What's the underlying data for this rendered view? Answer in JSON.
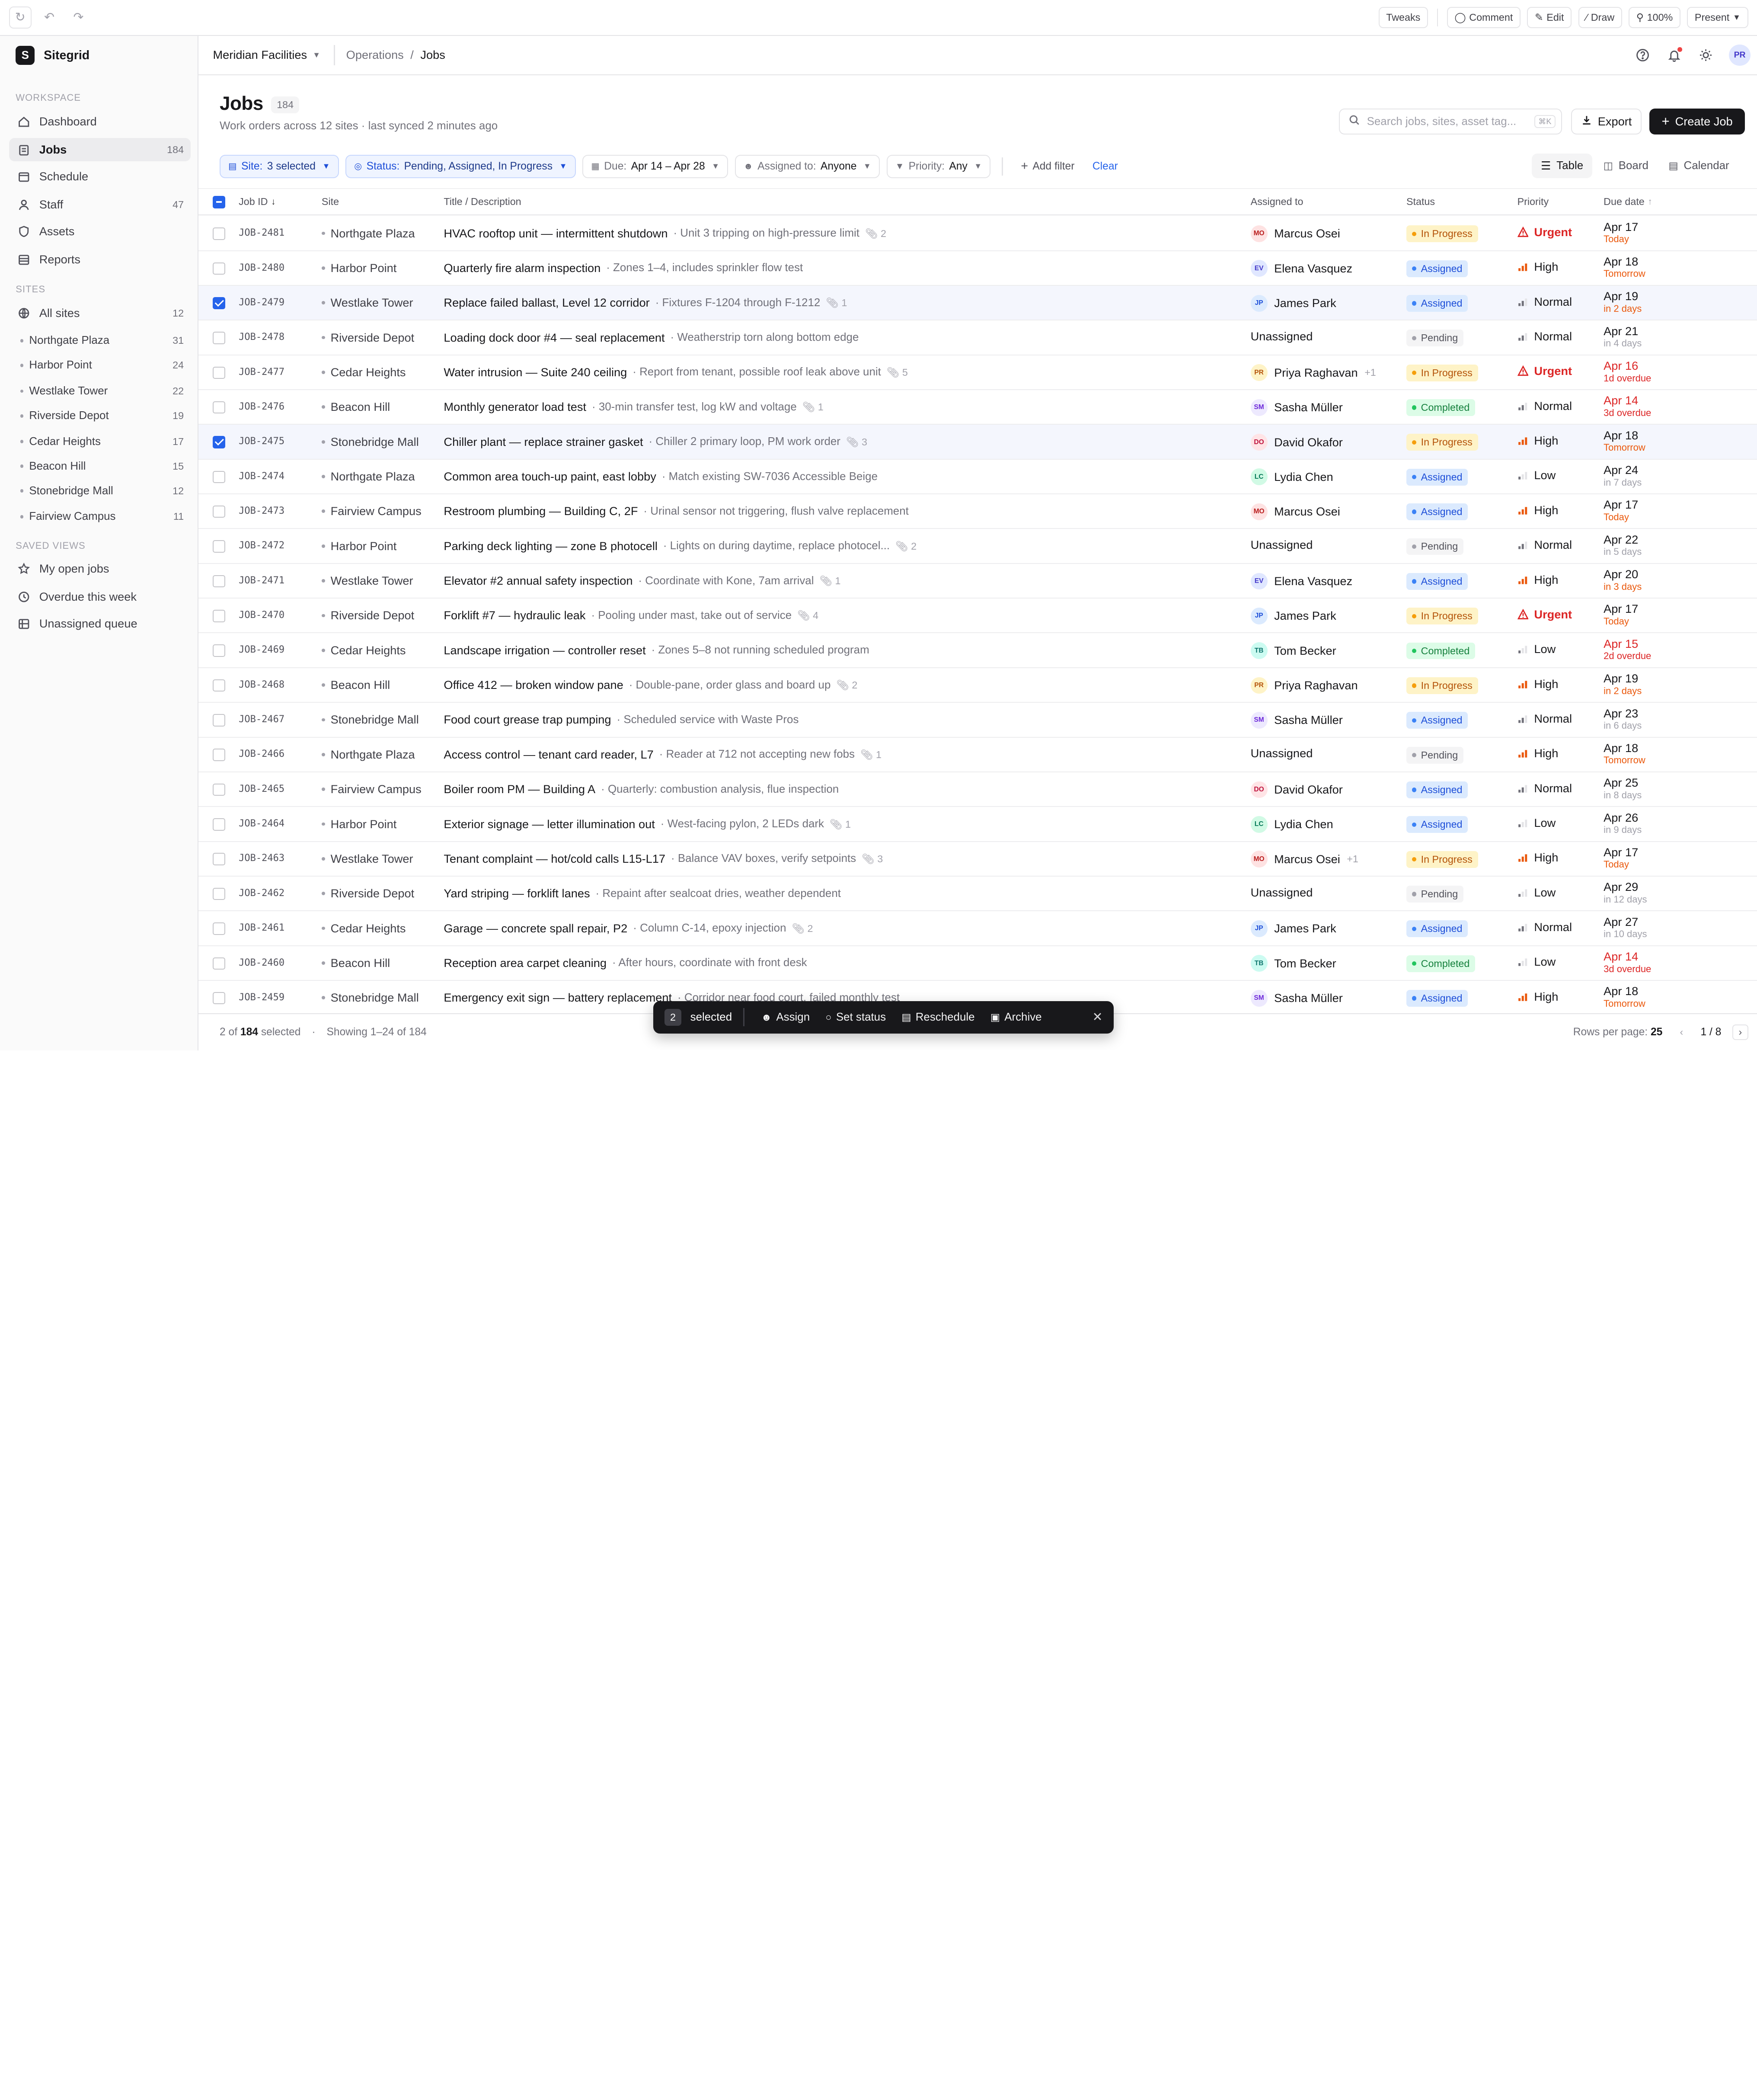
{
  "topbar": {
    "tweaks": "Tweaks",
    "comment": "Comment",
    "edit": "Edit",
    "draw": "Draw",
    "zoom": "100%",
    "present": "Present"
  },
  "brand": {
    "logo": "S",
    "name": "Sitegrid"
  },
  "org": {
    "name": "Meridian Facilities"
  },
  "breadcrumb": {
    "parent": "Operations",
    "sep": "/",
    "current": "Jobs"
  },
  "user": {
    "initials": "PR"
  },
  "sidebar": {
    "workspace_label": "WORKSPACE",
    "nav": [
      {
        "label": "Dashboard",
        "count": "",
        "icon": "home-icon"
      },
      {
        "label": "Jobs",
        "count": "184",
        "icon": "clipboard-icon"
      },
      {
        "label": "Schedule",
        "count": "",
        "icon": "calendar-icon"
      },
      {
        "label": "Staff",
        "count": "47",
        "icon": "user-icon"
      },
      {
        "label": "Assets",
        "count": "",
        "icon": "shield-icon"
      },
      {
        "label": "Reports",
        "count": "",
        "icon": "report-icon"
      }
    ],
    "sites_label": "SITES",
    "all_sites": {
      "label": "All sites",
      "count": "12"
    },
    "sites": [
      {
        "label": "Northgate Plaza",
        "count": "31"
      },
      {
        "label": "Harbor Point",
        "count": "24"
      },
      {
        "label": "Westlake Tower",
        "count": "22"
      },
      {
        "label": "Riverside Depot",
        "count": "19"
      },
      {
        "label": "Cedar Heights",
        "count": "17"
      },
      {
        "label": "Beacon Hill",
        "count": "15"
      },
      {
        "label": "Stonebridge Mall",
        "count": "12"
      },
      {
        "label": "Fairview Campus",
        "count": "11"
      }
    ],
    "views_label": "SAVED VIEWS",
    "views": [
      {
        "label": "My open jobs",
        "icon": "star-icon"
      },
      {
        "label": "Overdue this week",
        "icon": "clock-icon"
      },
      {
        "label": "Unassigned queue",
        "icon": "queue-icon"
      }
    ]
  },
  "page": {
    "title": "Jobs",
    "count": "184",
    "subtitle": "Work orders across 12 sites · last synced 2 minutes ago"
  },
  "search": {
    "placeholder": "Search jobs, sites, asset tag...",
    "kbd": "⌘K"
  },
  "actions": {
    "export": "Export",
    "create": "Create Job"
  },
  "filters": [
    {
      "key": "Site:",
      "value": "3 selected",
      "active": true
    },
    {
      "key": "Status:",
      "value": "Pending, Assigned, In Progress",
      "active": true
    },
    {
      "key": "Due:",
      "value": "Apr 14 – Apr 28",
      "active": false
    },
    {
      "key": "Assigned to:",
      "value": "Anyone",
      "active": false
    },
    {
      "key": "Priority:",
      "value": "Any",
      "active": false
    }
  ],
  "add_filter": "Add filter",
  "clear": "Clear",
  "views": {
    "table": "Table",
    "board": "Board",
    "calendar": "Calendar"
  },
  "columns": {
    "id": "Job ID",
    "site": "Site",
    "title": "Title / Description",
    "assigned": "Assigned to",
    "status": "Status",
    "priority": "Priority",
    "due": "Due date"
  },
  "colors": {
    "accent": "#2563eb",
    "urgent": "#dc2626",
    "high": "#ea580c",
    "overdue": "#dc2626",
    "soon": "#ea580c"
  },
  "rows": [
    {
      "id": "JOB-2481",
      "site": "Northgate Plaza",
      "title": "HVAC rooftop unit — intermittent shutdown",
      "desc": "· Unit 3 tripping on high-pressure limit",
      "att": "2",
      "initials": "MO",
      "assignee": "Marcus Osei",
      "plus": "",
      "status": "In Progress",
      "priority": "Urgent",
      "due": "Apr 17",
      "due_sub": "Today",
      "due_state": "soon",
      "checked": false
    },
    {
      "id": "JOB-2480",
      "site": "Harbor Point",
      "title": "Quarterly fire alarm inspection",
      "desc": "· Zones 1–4, includes sprinkler flow test",
      "att": "",
      "initials": "EV",
      "assignee": "Elena Vasquez",
      "plus": "",
      "status": "Assigned",
      "priority": "High",
      "due": "Apr 18",
      "due_sub": "Tomorrow",
      "due_state": "soon",
      "checked": false
    },
    {
      "id": "JOB-2479",
      "site": "Westlake Tower",
      "title": "Replace failed ballast, Level 12 corridor",
      "desc": "· Fixtures F-1204 through F-1212",
      "att": "1",
      "initials": "JP",
      "assignee": "James Park",
      "plus": "",
      "status": "Assigned",
      "priority": "Normal",
      "due": "Apr 19",
      "due_sub": "in 2 days",
      "due_state": "soon",
      "checked": true
    },
    {
      "id": "JOB-2478",
      "site": "Riverside Depot",
      "title": "Loading dock door #4 — seal replacement",
      "desc": "· Weatherstrip torn along bottom edge",
      "att": "",
      "initials": "",
      "assignee": "Unassigned",
      "plus": "",
      "status": "Pending",
      "priority": "Normal",
      "due": "Apr 21",
      "due_sub": "in 4 days",
      "due_state": "normal",
      "checked": false
    },
    {
      "id": "JOB-2477",
      "site": "Cedar Heights",
      "title": "Water intrusion — Suite 240 ceiling",
      "desc": "· Report from tenant, possible roof leak above unit",
      "att": "5",
      "initials": "PR",
      "assignee": "Priya Raghavan",
      "plus": "+1",
      "status": "In Progress",
      "priority": "Urgent",
      "due": "Apr 16",
      "due_sub": "1d overdue",
      "due_state": "overdue",
      "checked": false
    },
    {
      "id": "JOB-2476",
      "site": "Beacon Hill",
      "title": "Monthly generator load test",
      "desc": "· 30-min transfer test, log kW and voltage",
      "att": "1",
      "initials": "SM",
      "assignee": "Sasha Müller",
      "plus": "",
      "status": "Completed",
      "priority": "Normal",
      "due": "Apr 14",
      "due_sub": "3d overdue",
      "due_state": "overdue",
      "checked": false
    },
    {
      "id": "JOB-2475",
      "site": "Stonebridge Mall",
      "title": "Chiller plant — replace strainer gasket",
      "desc": "· Chiller 2 primary loop, PM work order",
      "att": "3",
      "initials": "DO",
      "assignee": "David Okafor",
      "plus": "",
      "status": "In Progress",
      "priority": "High",
      "due": "Apr 18",
      "due_sub": "Tomorrow",
      "due_state": "soon",
      "checked": true
    },
    {
      "id": "JOB-2474",
      "site": "Northgate Plaza",
      "title": "Common area touch-up paint, east lobby",
      "desc": "· Match existing SW-7036 Accessible Beige",
      "att": "",
      "initials": "LC",
      "assignee": "Lydia Chen",
      "plus": "",
      "status": "Assigned",
      "priority": "Low",
      "due": "Apr 24",
      "due_sub": "in 7 days",
      "due_state": "normal",
      "checked": false
    },
    {
      "id": "JOB-2473",
      "site": "Fairview Campus",
      "title": "Restroom plumbing — Building C, 2F",
      "desc": "· Urinal sensor not triggering, flush valve replacement",
      "att": "",
      "initials": "MO",
      "assignee": "Marcus Osei",
      "plus": "",
      "status": "Assigned",
      "priority": "High",
      "due": "Apr 17",
      "due_sub": "Today",
      "due_state": "soon",
      "checked": false
    },
    {
      "id": "JOB-2472",
      "site": "Harbor Point",
      "title": "Parking deck lighting — zone B photocell",
      "desc": "· Lights on during daytime, replace photocel...",
      "att": "2",
      "initials": "",
      "assignee": "Unassigned",
      "plus": "",
      "status": "Pending",
      "priority": "Normal",
      "due": "Apr 22",
      "due_sub": "in 5 days",
      "due_state": "normal",
      "checked": false
    },
    {
      "id": "JOB-2471",
      "site": "Westlake Tower",
      "title": "Elevator #2 annual safety inspection",
      "desc": "· Coordinate with Kone, 7am arrival",
      "att": "1",
      "initials": "EV",
      "assignee": "Elena Vasquez",
      "plus": "",
      "status": "Assigned",
      "priority": "High",
      "due": "Apr 20",
      "due_sub": "in 3 days",
      "due_state": "soon",
      "checked": false
    },
    {
      "id": "JOB-2470",
      "site": "Riverside Depot",
      "title": "Forklift #7 — hydraulic leak",
      "desc": "· Pooling under mast, take out of service",
      "att": "4",
      "initials": "JP",
      "assignee": "James Park",
      "plus": "",
      "status": "In Progress",
      "priority": "Urgent",
      "due": "Apr 17",
      "due_sub": "Today",
      "due_state": "soon",
      "checked": false
    },
    {
      "id": "JOB-2469",
      "site": "Cedar Heights",
      "title": "Landscape irrigation — controller reset",
      "desc": "· Zones 5–8 not running scheduled program",
      "att": "",
      "initials": "TB",
      "assignee": "Tom Becker",
      "plus": "",
      "status": "Completed",
      "priority": "Low",
      "due": "Apr 15",
      "due_sub": "2d overdue",
      "due_state": "overdue",
      "checked": false
    },
    {
      "id": "JOB-2468",
      "site": "Beacon Hill",
      "title": "Office 412 — broken window pane",
      "desc": "· Double-pane, order glass and board up",
      "att": "2",
      "initials": "PR",
      "assignee": "Priya Raghavan",
      "plus": "",
      "status": "In Progress",
      "priority": "High",
      "due": "Apr 19",
      "due_sub": "in 2 days",
      "due_state": "soon",
      "checked": false
    },
    {
      "id": "JOB-2467",
      "site": "Stonebridge Mall",
      "title": "Food court grease trap pumping",
      "desc": "· Scheduled service with Waste Pros",
      "att": "",
      "initials": "SM",
      "assignee": "Sasha Müller",
      "plus": "",
      "status": "Assigned",
      "priority": "Normal",
      "due": "Apr 23",
      "due_sub": "in 6 days",
      "due_state": "normal",
      "checked": false
    },
    {
      "id": "JOB-2466",
      "site": "Northgate Plaza",
      "title": "Access control — tenant card reader, L7",
      "desc": "· Reader at 712 not accepting new fobs",
      "att": "1",
      "initials": "",
      "assignee": "Unassigned",
      "plus": "",
      "status": "Pending",
      "priority": "High",
      "due": "Apr 18",
      "due_sub": "Tomorrow",
      "due_state": "soon",
      "checked": false
    },
    {
      "id": "JOB-2465",
      "site": "Fairview Campus",
      "title": "Boiler room PM — Building A",
      "desc": "· Quarterly: combustion analysis, flue inspection",
      "att": "",
      "initials": "DO",
      "assignee": "David Okafor",
      "plus": "",
      "status": "Assigned",
      "priority": "Normal",
      "due": "Apr 25",
      "due_sub": "in 8 days",
      "due_state": "normal",
      "checked": false
    },
    {
      "id": "JOB-2464",
      "site": "Harbor Point",
      "title": "Exterior signage — letter illumination out",
      "desc": "· West-facing pylon, 2 LEDs dark",
      "att": "1",
      "initials": "LC",
      "assignee": "Lydia Chen",
      "plus": "",
      "status": "Assigned",
      "priority": "Low",
      "due": "Apr 26",
      "due_sub": "in 9 days",
      "due_state": "normal",
      "checked": false
    },
    {
      "id": "JOB-2463",
      "site": "Westlake Tower",
      "title": "Tenant complaint — hot/cold calls L15-L17",
      "desc": "· Balance VAV boxes, verify setpoints",
      "att": "3",
      "initials": "MO",
      "assignee": "Marcus Osei",
      "plus": "+1",
      "status": "In Progress",
      "priority": "High",
      "due": "Apr 17",
      "due_sub": "Today",
      "due_state": "soon",
      "checked": false
    },
    {
      "id": "JOB-2462",
      "site": "Riverside Depot",
      "title": "Yard striping — forklift lanes",
      "desc": "· Repaint after sealcoat dries, weather dependent",
      "att": "",
      "initials": "",
      "assignee": "Unassigned",
      "plus": "",
      "status": "Pending",
      "priority": "Low",
      "due": "Apr 29",
      "due_sub": "in 12 days",
      "due_state": "normal",
      "checked": false
    },
    {
      "id": "JOB-2461",
      "site": "Cedar Heights",
      "title": "Garage — concrete spall repair, P2",
      "desc": "· Column C-14, epoxy injection",
      "att": "2",
      "initials": "JP",
      "assignee": "James Park",
      "plus": "",
      "status": "Assigned",
      "priority": "Normal",
      "due": "Apr 27",
      "due_sub": "in 10 days",
      "due_state": "normal",
      "checked": false
    },
    {
      "id": "JOB-2460",
      "site": "Beacon Hill",
      "title": "Reception area carpet cleaning",
      "desc": "· After hours, coordinate with front desk",
      "att": "",
      "initials": "TB",
      "assignee": "Tom Becker",
      "plus": "",
      "status": "Completed",
      "priority": "Low",
      "due": "Apr 14",
      "due_sub": "3d overdue",
      "due_state": "overdue",
      "checked": false
    },
    {
      "id": "JOB-2459",
      "site": "Stonebridge Mall",
      "title": "Emergency exit sign — battery replacement",
      "desc": "· Corridor near food court, failed monthly test",
      "att": "",
      "initials": "SM",
      "assignee": "Sasha Müller",
      "plus": "",
      "status": "Assigned",
      "priority": "High",
      "due": "Apr 18",
      "due_sub": "Tomorrow",
      "due_state": "soon",
      "checked": false
    }
  ],
  "footer": {
    "selected": "2",
    "total": "184",
    "of_label": "of",
    "selected_label": "selected",
    "sep": "·",
    "showing": "Showing 1–24 of 184",
    "rows_label": "Rows per page:",
    "rows_value": "25",
    "page": "1 / 8"
  },
  "actionbar": {
    "count": "2",
    "label": "selected",
    "assign": "Assign",
    "set_status": "Set status",
    "reschedule": "Reschedule",
    "archive": "Archive"
  }
}
